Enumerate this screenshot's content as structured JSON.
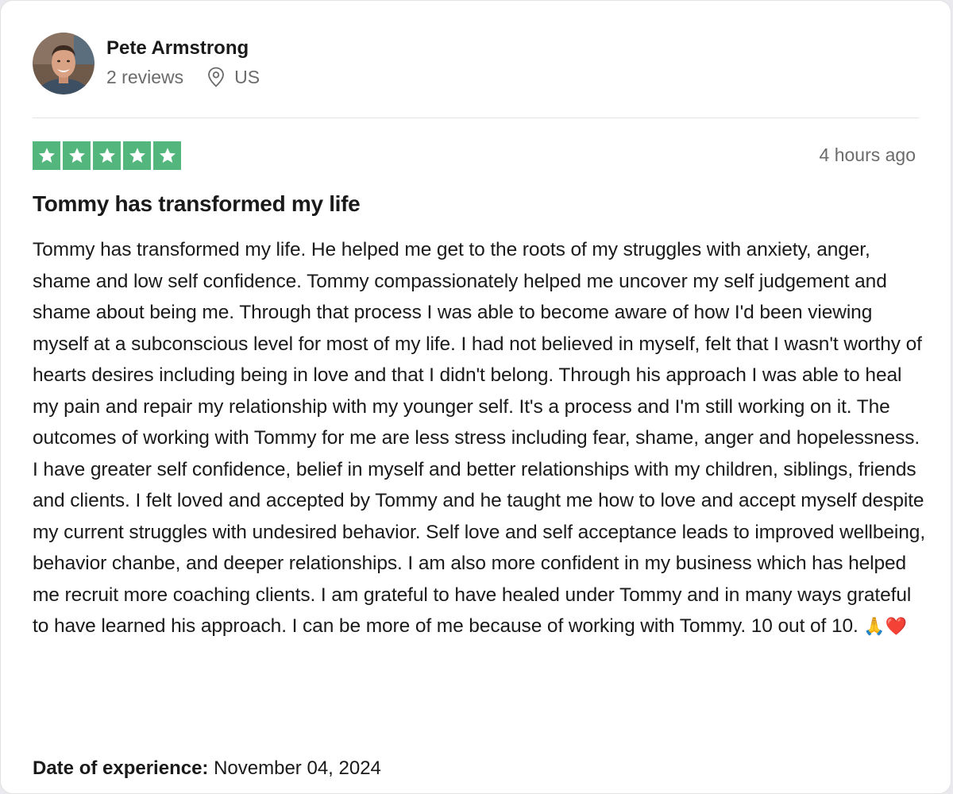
{
  "reviewer": {
    "name": "Pete Armstrong",
    "reviews_count": "2 reviews",
    "location": "US"
  },
  "review": {
    "rating": 5,
    "rating_max": 5,
    "time_ago": "4 hours ago",
    "title": "Tommy has transformed my life",
    "body": "Tommy has transformed my life. He helped me get to the roots of my struggles with anxiety, anger, shame and low self confidence. Tommy compassionately helped me uncover my self judgement and shame about being me. Through that process I was able to become aware of how I'd been viewing myself at a subconscious level for most of my life. I had not believed in myself, felt that I wasn't worthy of hearts desires including being in love and that I didn't belong. Through his approach I was able to heal my pain and repair my relationship with my younger self. It's a process and I'm still working on it. The outcomes of working with Tommy for me are less stress including fear, shame, anger and hopelessness. I have greater self confidence, belief in myself and better relationships with my children, siblings, friends and clients. I felt loved and accepted by Tommy and he taught me how to love and accept myself despite my current struggles with undesired behavior. Self love and self acceptance leads to improved wellbeing, behavior chanbe, and deeper relationships. I am also more confident in my business which has helped me recruit more coaching clients. I am grateful to have healed under Tommy and in many ways grateful to have learned his approach. I can be more of me because of working with Tommy. 10 out of 10.",
    "body_emoji": "🙏❤️",
    "date_label": "Date of experience:",
    "date_value": "November 04, 2024"
  },
  "icons": {
    "star": "star-icon",
    "location": "location-pin-icon",
    "avatar": "avatar-photo"
  },
  "colors": {
    "star_bg": "#53b67d",
    "text": "#1a1a1a",
    "muted": "#6b6b6b",
    "divider": "#e3e3e3"
  }
}
